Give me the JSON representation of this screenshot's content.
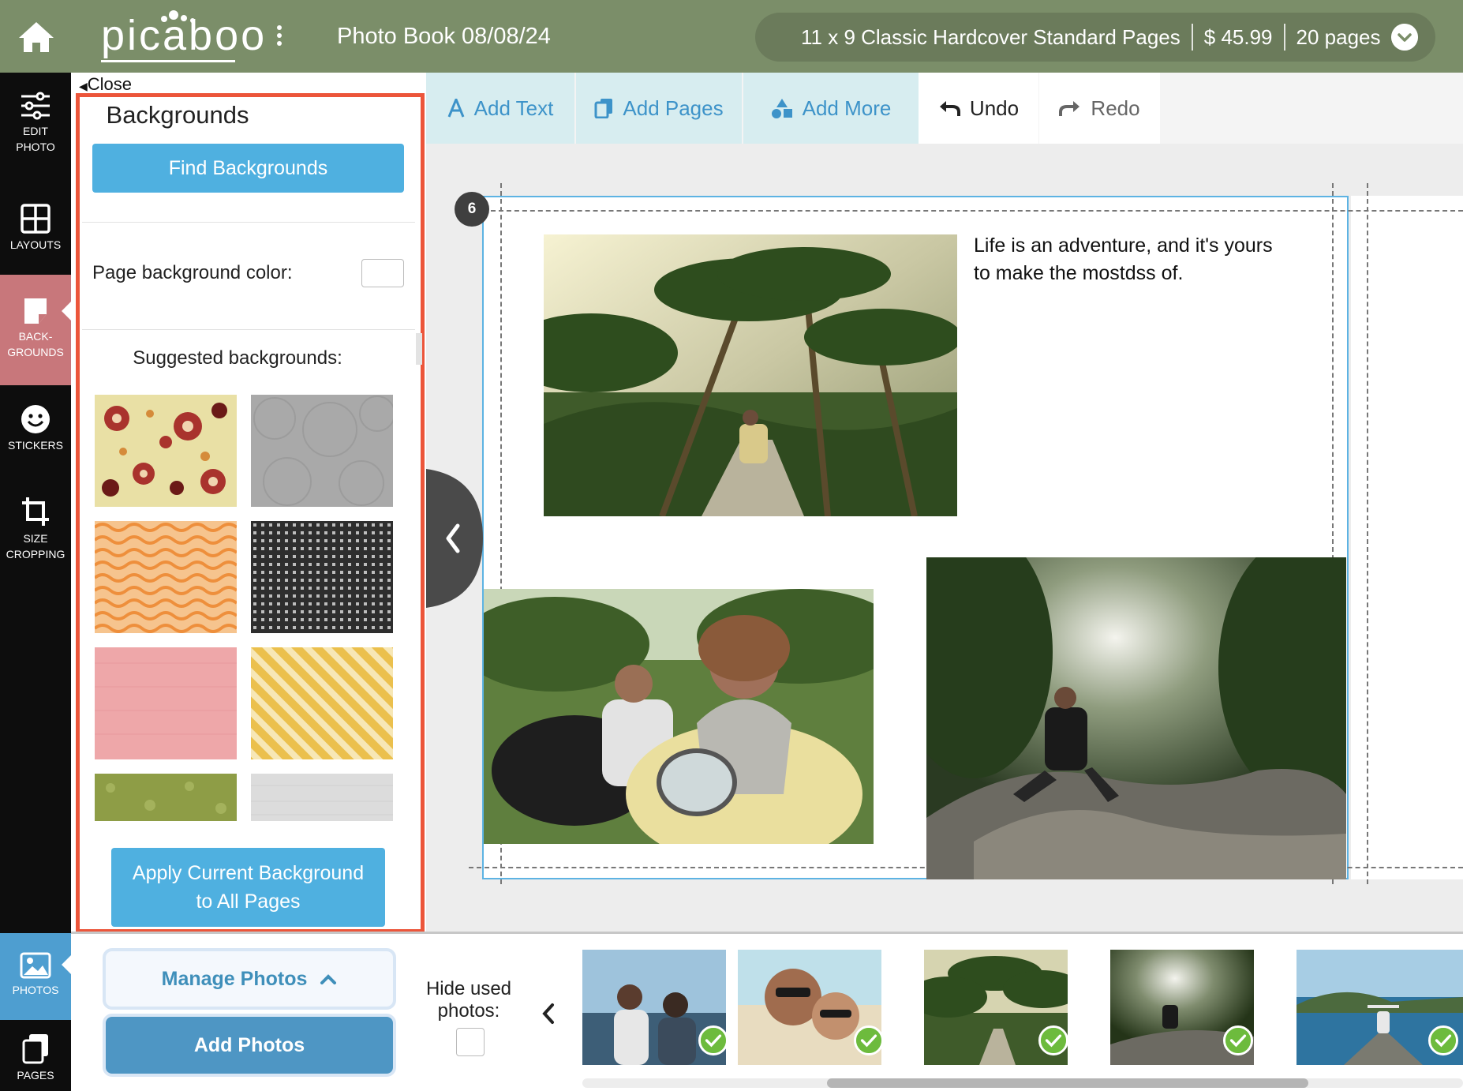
{
  "header": {
    "logo": "picaboo",
    "doc_title": "Photo Book 08/08/24",
    "product": "11 x 9 Classic Hardcover Standard Pages",
    "price": "$ 45.99",
    "pages": "20 pages"
  },
  "nav": {
    "edit_photo": [
      "EDIT",
      "PHOTO"
    ],
    "layouts": "LAYOUTS",
    "backgrounds": [
      "BACK-",
      "GROUNDS"
    ],
    "stickers": "STICKERS",
    "size_cropping": [
      "SIZE",
      "CROPPING"
    ],
    "photos": "PHOTOS",
    "pages": "PAGES"
  },
  "panel": {
    "close": "Close",
    "title": "Backgrounds",
    "find_button": "Find Backgrounds",
    "bg_color_label": "Page background color:",
    "bg_color_value": "#ffffff",
    "suggested_label": "Suggested backgrounds:",
    "apply_button": [
      "Apply Current Background",
      "to All Pages"
    ],
    "swatches": [
      {
        "name": "floral-red",
        "color": "#e9e0a5"
      },
      {
        "name": "gray-circles",
        "color": "#a9a9a9"
      },
      {
        "name": "orange-waves",
        "color": "#f0a35e"
      },
      {
        "name": "black-grid",
        "color": "#2e2e2e"
      },
      {
        "name": "pink-linen",
        "color": "#eea7a9"
      },
      {
        "name": "yellow-stripes",
        "color": "#f0cc69"
      },
      {
        "name": "green-floral",
        "color": "#8e9d46"
      },
      {
        "name": "light-gray-linen",
        "color": "#dcdcdc"
      }
    ]
  },
  "toolbar": {
    "add_text": "Add Text",
    "add_pages": "Add Pages",
    "add_more": "Add More",
    "undo": "Undo",
    "redo": "Redo"
  },
  "canvas": {
    "page_number": "6",
    "caption_line1": "Life is an adventure, and it's yours",
    "caption_line2": "to make the mostdss of."
  },
  "bottom": {
    "manage_photos": "Manage Photos",
    "add_photos": "Add Photos",
    "hide_used": [
      "Hide used",
      "photos:"
    ]
  },
  "colors": {
    "header_green": "#7b8e69",
    "accent_blue": "#4fb0e0",
    "highlight_red": "#ec553a",
    "active_nav": "#c8777b",
    "check_green": "#6dbb3d"
  }
}
